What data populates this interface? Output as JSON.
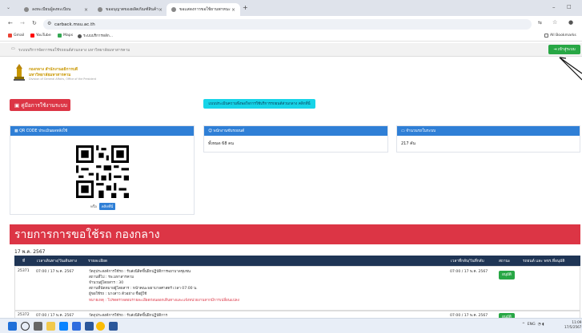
{
  "browser": {
    "tabs": [
      {
        "label": "ลงทะเบียนผู้ลงทะเบียน"
      },
      {
        "label": "ขออนุญาตของผลิตภัณฑ์สินค้า"
      },
      {
        "label": "ขอแสดงการขอใช้ยานพาหนะ"
      }
    ],
    "new_tab": "+",
    "url": "carback.msu.ac.th",
    "bookmarks": [
      "Gmail",
      "YouTube",
      "Maps",
      "ระบบบริการหลัก..."
    ],
    "all_bookmarks": "All Bookmarks"
  },
  "site": {
    "topbar_text": "ระบบบริการจัดการขอใช้รถยนต์ส่วนกลาง มหาวิทยาลัยมหาสารคาม",
    "login_button": "เข้าสู่ระบบ",
    "org_line1": "กองกลาง สำนักงานอธิการบดี",
    "org_line2": "มหาวิทยาลัยมหาสารคาม",
    "org_line3": "Division of General Affairs, Office of the President",
    "manual_button": "คู่มือการใช้งานระบบ",
    "info_button": "แบบประเมินความพึงพอใจการใช้บริการรถยนต์ส่วนกลาง คลิกที่นี่",
    "cards": {
      "qr": {
        "title": "QR CODE ประเมินผลหลังใช้",
        "link_prefix": "หรือ",
        "link_button": "คลิกที่นี่"
      },
      "drivers": {
        "title": "พนักงานขับรถยนต์",
        "value": "ทั้งหมด 68 คน"
      },
      "vehicles": {
        "title": "จำนวนรถในระบบ",
        "value": "217 คัน"
      }
    },
    "banner_title": "รายการการขอใช้รถ กองกลาง",
    "date_label": "17 พ.ค. 2567",
    "table": {
      "headers": [
        "ที่",
        "เวลาเดินทาง/วันเดินทาง",
        "รายละเอียด",
        "เวลาที่กลับ/วันที่กลับ",
        "สถานะ",
        "รถยนต์ และ พขร.ที่อนุมัติ"
      ],
      "rows": [
        {
          "id": "25371",
          "depart": "07:00 / 17 พ.ค. 2567",
          "purpose": "วัตถุประสงค์การใช้รถ : รับส่งนิสิตขึ้นฝึกปฏิบัติการพยาบาลชุมชน",
          "place": "สถานที่ไป : รพ.มหาสารคาม",
          "people": "จำนวนผู้โดยสาร : 30",
          "pickup": "สถานที่นัดหมายผู้โดยสาร : หน้าคณะพยาบาลศาสตร์ เวลา 07:00 น.",
          "requester": "ผู้ขอใช้รถ : นางสาว ตัวอย่าง ชื่อผู้ใช้",
          "note": "หมายเหตุ : โปรดตรวจสอบรายละเอียดก่อนออกเดินทางและแจ้งหน่วยงานหากมีการเปลี่ยนแปลง",
          "return": "07:00 / 17 พ.ค. 2567",
          "status": "อนุมัติ"
        },
        {
          "id": "25372",
          "depart": "07:00 / 17 พ.ค. 2567",
          "purpose": "วัตถุประสงค์การใช้รถ : รับส่งนิสิตขึ้นฝึกปฏิบัติการ",
          "return": "07:00 / 17 พ.ค. 2567",
          "status": "อนุมัติ"
        }
      ]
    }
  },
  "taskbar": {
    "tray": "ENG",
    "time": "11:09",
    "date": "17/5/2567"
  },
  "colors": {
    "primary": "#2f7fd6",
    "danger": "#dc3545",
    "success": "#28a745",
    "info": "#17d4e8"
  }
}
